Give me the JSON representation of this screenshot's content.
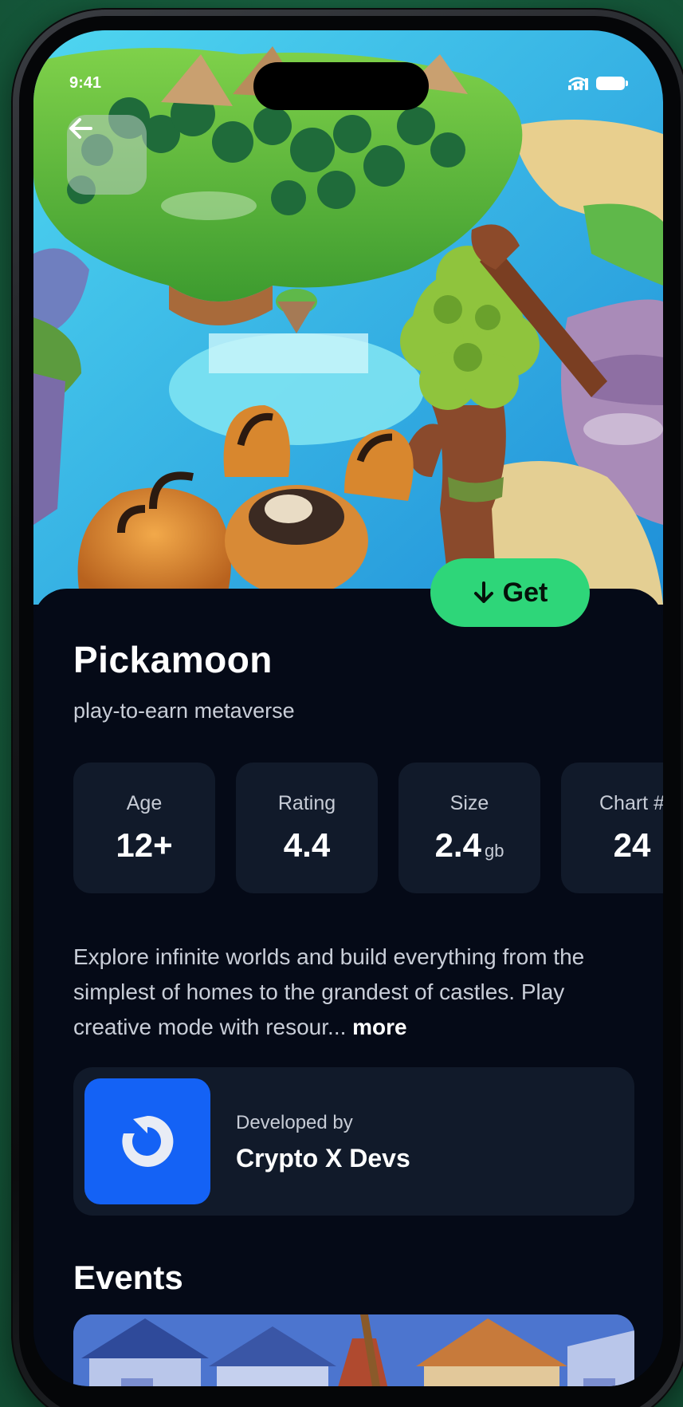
{
  "status_bar": {
    "time": "9:41"
  },
  "app": {
    "name": "Pickamoon",
    "tagline": "play-to-earn metaverse",
    "get_label": "Get"
  },
  "stats": [
    {
      "label": "Age",
      "value": "12+",
      "unit": ""
    },
    {
      "label": "Rating",
      "value": "4.4",
      "unit": ""
    },
    {
      "label": "Size",
      "value": "2.4",
      "unit": "gb"
    },
    {
      "label": "Chart #",
      "value": "24",
      "unit": ""
    }
  ],
  "description": {
    "text": "Explore infinite worlds and build everything from the simplest of homes to the grandest of castles. Play creative mode with resour...",
    "more_label": "more"
  },
  "developer": {
    "caption": "Developed by",
    "name": "Crypto X Devs"
  },
  "events": {
    "title": "Events"
  },
  "colors": {
    "accent": "#2ed679",
    "background": "#050a17",
    "card": "#111a2a",
    "developer_logo": "#1462f5"
  },
  "icons": {
    "back": "arrow-left-icon",
    "get": "arrow-down-icon",
    "developer": "developer-logo-icon"
  }
}
